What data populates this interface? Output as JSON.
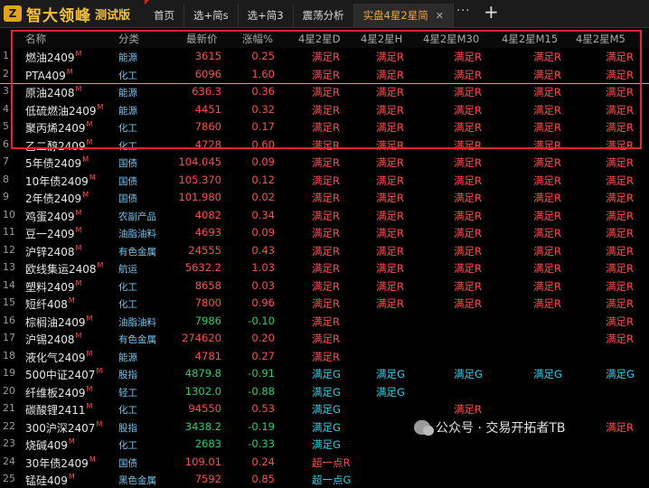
{
  "brand": {
    "logo": "Z",
    "name": "智大领峰",
    "tag": "测试版"
  },
  "tabs": [
    {
      "label": "首页",
      "active": false,
      "closable": false
    },
    {
      "label": "选+简s",
      "active": false,
      "closable": false
    },
    {
      "label": "选+简3",
      "active": false,
      "closable": false
    },
    {
      "label": "震荡分析",
      "active": false,
      "closable": false
    },
    {
      "label": "实盘4星2星简",
      "active": true,
      "closable": true
    }
  ],
  "toolbar": {
    "more": "···",
    "add": "+"
  },
  "columns": [
    "名称",
    "分类",
    "最新价",
    "涨幅%",
    "4星2星D",
    "4星2星H",
    "4星2星M30",
    "4星2星M15",
    "4星2星M5"
  ],
  "rows": [
    {
      "n": "1",
      "name": "燃油2409",
      "mark": "M",
      "cat": "能源",
      "price": "3615",
      "chg": "0.25",
      "dir": "up",
      "d": "满足R",
      "h": "满足R",
      "m30": "满足R",
      "m15": "满足R",
      "m5": "满足R"
    },
    {
      "n": "2",
      "name": "PTA409",
      "mark": "M",
      "cat": "化工",
      "price": "6096",
      "chg": "1.60",
      "dir": "up",
      "d": "满足R",
      "h": "满足R",
      "m30": "满足R",
      "m15": "满足R",
      "m5": "满足R"
    },
    {
      "n": "3",
      "name": "原油2408",
      "mark": "M",
      "cat": "能源",
      "price": "636.3",
      "chg": "0.36",
      "dir": "up",
      "d": "满足R",
      "h": "满足R",
      "m30": "满足R",
      "m15": "满足R",
      "m5": "满足R"
    },
    {
      "n": "4",
      "name": "低硫燃油2409",
      "mark": "M",
      "cat": "能源",
      "price": "4451",
      "chg": "0.32",
      "dir": "up",
      "d": "满足R",
      "h": "满足R",
      "m30": "满足R",
      "m15": "满足R",
      "m5": "满足R"
    },
    {
      "n": "5",
      "name": "聚丙烯2409",
      "mark": "M",
      "cat": "化工",
      "price": "7860",
      "chg": "0.17",
      "dir": "up",
      "d": "满足R",
      "h": "满足R",
      "m30": "满足R",
      "m15": "满足R",
      "m5": "满足R"
    },
    {
      "n": "6",
      "name": "乙二醇2409",
      "mark": "M",
      "cat": "化工",
      "price": "4728",
      "chg": "0.60",
      "dir": "up",
      "d": "满足R",
      "h": "满足R",
      "m30": "满足R",
      "m15": "满足R",
      "m5": "满足R"
    },
    {
      "n": "7",
      "name": "5年债2409",
      "mark": "M",
      "cat": "国债",
      "price": "104.045",
      "chg": "0.09",
      "dir": "up",
      "d": "满足R",
      "h": "满足R",
      "m30": "满足R",
      "m15": "满足R",
      "m5": "满足R"
    },
    {
      "n": "8",
      "name": "10年债2409",
      "mark": "M",
      "cat": "国债",
      "price": "105.370",
      "chg": "0.12",
      "dir": "up",
      "d": "满足R",
      "h": "满足R",
      "m30": "满足R",
      "m15": "满足R",
      "m5": "满足R"
    },
    {
      "n": "9",
      "name": "2年债2409",
      "mark": "M",
      "cat": "国债",
      "price": "101.980",
      "chg": "0.02",
      "dir": "up",
      "d": "满足R",
      "h": "满足R",
      "m30": "满足R",
      "m15": "满足R",
      "m5": "满足R"
    },
    {
      "n": "10",
      "name": "鸡蛋2409",
      "mark": "M",
      "cat": "农副产品",
      "price": "4082",
      "chg": "0.34",
      "dir": "up",
      "d": "满足R",
      "h": "满足R",
      "m30": "满足R",
      "m15": "满足R",
      "m5": "满足R"
    },
    {
      "n": "11",
      "name": "豆一2409",
      "mark": "M",
      "cat": "油脂油料",
      "price": "4693",
      "chg": "0.09",
      "dir": "up",
      "d": "满足R",
      "h": "满足R",
      "m30": "满足R",
      "m15": "满足R",
      "m5": "满足R"
    },
    {
      "n": "12",
      "name": "沪锌2408",
      "mark": "M",
      "cat": "有色金属",
      "price": "24555",
      "chg": "0.43",
      "dir": "up",
      "d": "满足R",
      "h": "满足R",
      "m30": "满足R",
      "m15": "满足R",
      "m5": "满足R"
    },
    {
      "n": "13",
      "name": "欧线集运2408",
      "mark": "M",
      "cat": "航运",
      "price": "5632.2",
      "chg": "1.03",
      "dir": "up",
      "d": "满足R",
      "h": "满足R",
      "m30": "满足R",
      "m15": "满足R",
      "m5": "满足R"
    },
    {
      "n": "14",
      "name": "塑料2409",
      "mark": "M",
      "cat": "化工",
      "price": "8658",
      "chg": "0.03",
      "dir": "up",
      "d": "满足R",
      "h": "满足R",
      "m30": "满足R",
      "m15": "满足R",
      "m5": "满足R"
    },
    {
      "n": "15",
      "name": "短纤408",
      "mark": "M",
      "cat": "化工",
      "price": "7800",
      "chg": "0.96",
      "dir": "up",
      "d": "满足R",
      "h": "满足R",
      "m30": "满足R",
      "m15": "满足R",
      "m5": "满足R"
    },
    {
      "n": "16",
      "name": "棕榈油2409",
      "mark": "M",
      "cat": "油脂油料",
      "price": "7986",
      "chg": "-0.10",
      "dir": "dn",
      "d": "满足R",
      "h": "",
      "m30": "",
      "m15": "",
      "m5": "满足R"
    },
    {
      "n": "17",
      "name": "沪锡2408",
      "mark": "M",
      "cat": "有色金属",
      "price": "274620",
      "chg": "0.20",
      "dir": "up",
      "d": "满足R",
      "h": "",
      "m30": "",
      "m15": "",
      "m5": "满足R"
    },
    {
      "n": "18",
      "name": "液化气2409",
      "mark": "M",
      "cat": "能源",
      "price": "4781",
      "chg": "0.27",
      "dir": "up",
      "d": "满足R",
      "h": "",
      "m30": "",
      "m15": "",
      "m5": ""
    },
    {
      "n": "19",
      "name": "500中证2407",
      "mark": "M",
      "cat": "股指",
      "price": "4879.8",
      "chg": "-0.91",
      "dir": "dn",
      "d": "满足G",
      "h": "满足G",
      "m30": "满足G",
      "m15": "满足G",
      "m5": "满足G"
    },
    {
      "n": "20",
      "name": "纤维板2409",
      "mark": "M",
      "cat": "轻工",
      "price": "1302.0",
      "chg": "-0.88",
      "dir": "dn",
      "d": "满足G",
      "h": "满足G",
      "m30": "",
      "m15": "",
      "m5": ""
    },
    {
      "n": "21",
      "name": "碳酸锂2411",
      "mark": "M",
      "cat": "化工",
      "price": "94550",
      "chg": "0.53",
      "dir": "up",
      "d": "满足G",
      "h": "",
      "m30": "满足R",
      "m15": "",
      "m5": ""
    },
    {
      "n": "22",
      "name": "300沪深2407",
      "mark": "M",
      "cat": "股指",
      "price": "3438.2",
      "chg": "-0.19",
      "dir": "dn",
      "d": "满足G",
      "h": "",
      "m30": "",
      "m15": "",
      "m5": "满足R"
    },
    {
      "n": "23",
      "name": "烧碱409",
      "mark": "M",
      "cat": "化工",
      "price": "2683",
      "chg": "-0.33",
      "dir": "dn",
      "d": "满足G",
      "h": "",
      "m30": "",
      "m15": "",
      "m5": ""
    },
    {
      "n": "24",
      "name": "30年债2409",
      "mark": "M",
      "cat": "国债",
      "price": "109.01",
      "chg": "0.24",
      "dir": "up",
      "d": "超一点R",
      "h": "",
      "m30": "",
      "m15": "",
      "m5": ""
    },
    {
      "n": "25",
      "name": "锰硅409",
      "mark": "M",
      "cat": "黑色金属",
      "price": "7592",
      "chg": "0.85",
      "dir": "up",
      "d": "超一点G",
      "h": "",
      "m30": "",
      "m15": "",
      "m5": ""
    }
  ],
  "watermark": {
    "text": "公众号 · 交易开拓者TB"
  },
  "colors": {
    "up": "#ff4d4d",
    "down": "#22d36b",
    "signal_red": "#ff4d4d",
    "signal_cyan": "#2ad0e8",
    "accent": "#f2c233",
    "highlight_box": "#e8232a"
  }
}
